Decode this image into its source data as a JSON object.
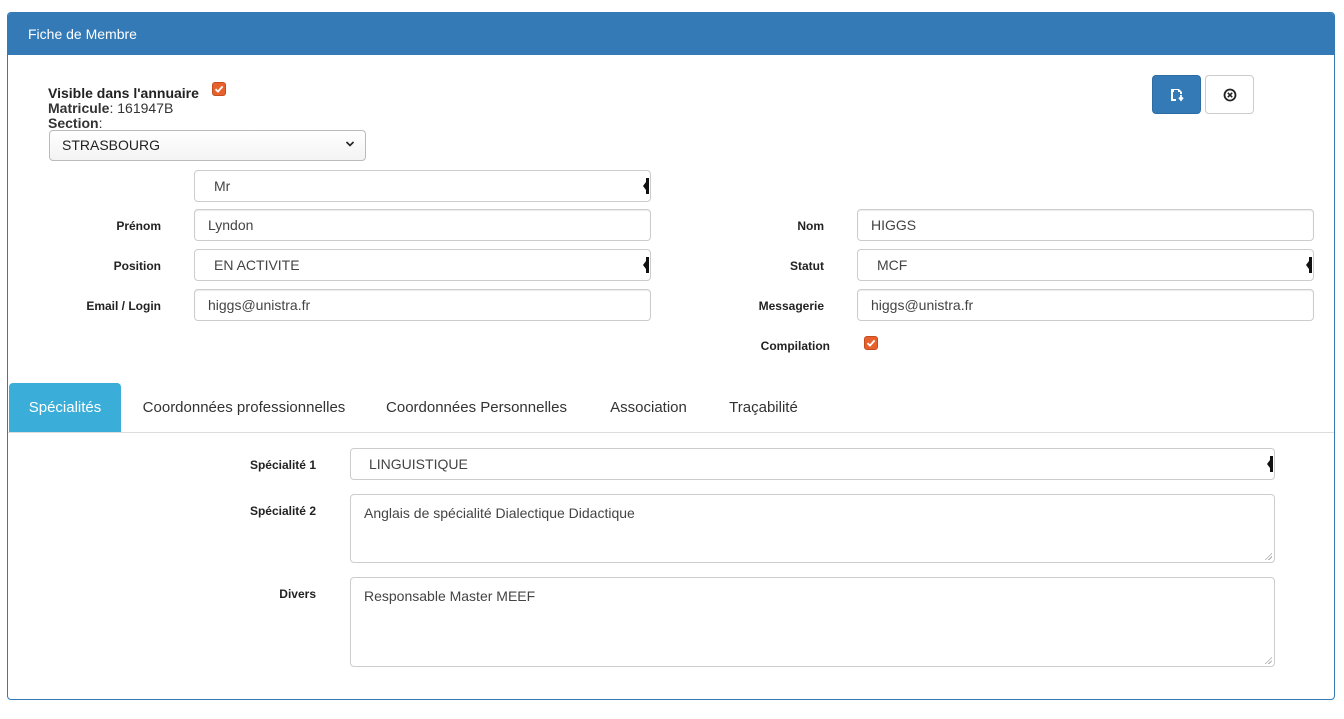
{
  "panel": {
    "title": "Fiche de Membre"
  },
  "header": {
    "visible_label": "Visible dans l'annuaire",
    "visible_checked": true,
    "matricule_label": "Matricule",
    "matricule_value": ": 161947B",
    "section_label": "Section",
    "section_colon": ":",
    "section_value": "STRASBOURG"
  },
  "actions": {
    "save_icon": "save-icon",
    "cancel_icon": "close-circle-icon"
  },
  "form": {
    "civility_value": "Mr",
    "prenom_label": "Prénom",
    "prenom_value": "Lyndon",
    "nom_label": "Nom",
    "nom_value": "HIGGS",
    "position_label": "Position",
    "position_value": "EN ACTIVITE",
    "statut_label": "Statut",
    "statut_value": "MCF",
    "email_label": "Email / Login",
    "email_value": "higgs@unistra.fr",
    "messagerie_label": "Messagerie",
    "messagerie_value": "higgs@unistra.fr",
    "compilation_label": "Compilation",
    "compilation_checked": true
  },
  "tabs": [
    {
      "label": "Spécialités",
      "active": true
    },
    {
      "label": "Coordonnées professionnelles",
      "active": false
    },
    {
      "label": "Coordonnées Personnelles",
      "active": false
    },
    {
      "label": "Association",
      "active": false
    },
    {
      "label": "Traçabilité",
      "active": false
    }
  ],
  "specialites": {
    "spec1_label": "Spécialité 1",
    "spec1_value": "LINGUISTIQUE",
    "spec2_label": "Spécialité 2",
    "spec2_value": "Anglais de spécialité Dialectique Didactique",
    "divers_label": "Divers",
    "divers_value": "Responsable Master MEEF"
  },
  "colors": {
    "primary": "#337ab7",
    "tab_active": "#3aaed8",
    "checkbox": "#e8612c"
  }
}
